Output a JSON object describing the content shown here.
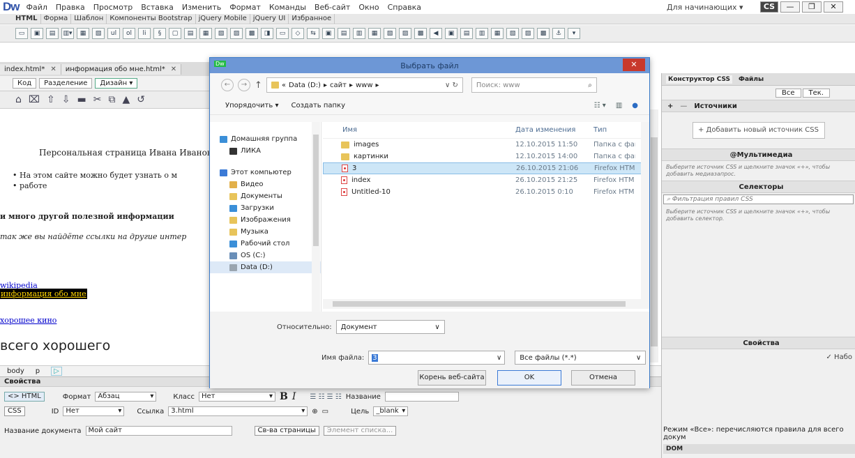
{
  "app": {
    "logo": "Dw",
    "menu": [
      "Файл",
      "Правка",
      "Просмотр",
      "Вставка",
      "Изменить",
      "Формат",
      "Команды",
      "Веб-сайт",
      "Окно",
      "Справка"
    ],
    "workspace": "Для начинающих ▾",
    "cs_label": "CS"
  },
  "insert_tabs": [
    "HTML",
    "Форма",
    "Шаблон",
    "Компоненты Bootstrap",
    "jQuery Mobile",
    "jQuery UI",
    "Избранное"
  ],
  "insert_icons": [
    "▭",
    "▣",
    "▤",
    "▥▾",
    "▦",
    "▧",
    "ul",
    "ol",
    "li",
    "§",
    "▢",
    "▤",
    "▦",
    "▧",
    "▨",
    "▩",
    "◨",
    "▭",
    "◇",
    "⇆",
    "▣",
    "▤",
    "▥",
    "▦",
    "▧",
    "▨",
    "▩",
    "◀",
    "▣",
    "▤",
    "▥",
    "▦",
    "▧",
    "▨",
    "▩",
    "⚓",
    "▾"
  ],
  "doc_tabs": [
    {
      "label": "index.html*"
    },
    {
      "label": "информация обо мне.html*"
    }
  ],
  "views": [
    "Код",
    "Разделение",
    "Дизайн ▾"
  ],
  "doc_tools": [
    "⌂",
    "⌧",
    "⇧",
    "⇩",
    "▬",
    "✂",
    "⧉",
    "▲",
    "↺"
  ],
  "design": {
    "title": "Персональная страница Ивана Иванов",
    "list": [
      "На этом сайте можно будет узнать о м",
      "работе"
    ],
    "bold_line": "и много другой полезной информации",
    "italic_line": "так же вы найдёте ссылки на другие интер",
    "link1": "wikipedia",
    "highlight": "информация обо мне",
    "link2": "хорошее кино",
    "big": "всего хорошего"
  },
  "tagbar": {
    "body": "body",
    "p": "p",
    "icon": "▷"
  },
  "properties": {
    "header": "Свойства",
    "html_btn": "<> HTML",
    "css_btn": "CSS",
    "format_label": "Формат",
    "format_value": "Абзац",
    "class_label": "Класс",
    "class_value": "Нет",
    "id_label": "ID",
    "id_value": "Нет",
    "link_label": "Ссылка",
    "link_value": "3.html",
    "bold": "B",
    "italic": "I",
    "name_label": "Название",
    "target_label": "Цель",
    "target_value": "_blank",
    "doc_title_label": "Название документа",
    "doc_title_value": "Мой сайт",
    "page_props": "Св-ва страницы",
    "list_item": "Элемент списка..."
  },
  "right_panel": {
    "tabs": [
      "Конструктор CSS",
      "Файлы"
    ],
    "modes": [
      "Все",
      "Тек."
    ],
    "sources": "Источники",
    "add_source": "+ Добавить новый источник CSS",
    "media": "@Мультимедиа",
    "media_hint": "Выберите источник CSS и щелкните значок «+», чтобы добавить медиазапрос.",
    "selectors": "Селекторы",
    "filter_placeholder": "Фильтрация правил CSS",
    "selectors_hint": "Выберите источник CSS и щелкните значок «+», чтобы добавить селектор.",
    "properties": "Свойства",
    "set_checkbox": "✓ Набо",
    "bottom_note": "Режим «Все»: перечисляются правила для всего докум",
    "dom": "DOM"
  },
  "dialog": {
    "title": "Выбрать файл",
    "close": "✕",
    "path": [
      "Data (D:)",
      "сайт",
      "www"
    ],
    "search_placeholder": "Поиск: www",
    "organize": "Упорядочить ▾",
    "new_folder": "Создать папку",
    "nav": [
      {
        "label": "Домашняя группа",
        "color": "#3b8fd8",
        "child": false
      },
      {
        "label": "ЛИКА",
        "color": "#333333",
        "child": true
      },
      {
        "label": "",
        "color": "",
        "gap": true
      },
      {
        "label": "Этот компьютер",
        "color": "#3b7ad6",
        "child": false
      },
      {
        "label": "Видео",
        "color": "#e2b04a",
        "child": true
      },
      {
        "label": "Документы",
        "color": "#e8c45a",
        "child": true
      },
      {
        "label": "Загрузки",
        "color": "#3b8fd8",
        "child": true
      },
      {
        "label": "Изображения",
        "color": "#e8c45a",
        "child": true
      },
      {
        "label": "Музыка",
        "color": "#e8c45a",
        "child": true
      },
      {
        "label": "Рабочий стол",
        "color": "#3b8fd8",
        "child": true
      },
      {
        "label": "OS (C:)",
        "color": "#6a8fb8",
        "child": true
      },
      {
        "label": "Data (D:)",
        "color": "#9aa5b0",
        "child": true,
        "selected": true
      }
    ],
    "columns": {
      "name": "Имя",
      "date": "Дата изменения",
      "type": "Тип"
    },
    "files": [
      {
        "name": "images",
        "date": "12.10.2015 11:50",
        "type": "Папка с фай",
        "kind": "folder"
      },
      {
        "name": "картинки",
        "date": "12.10.2015 14:00",
        "type": "Папка с фай",
        "kind": "folder"
      },
      {
        "name": "3",
        "date": "26.10.2015 21:06",
        "type": "Firefox HTM",
        "kind": "file",
        "selected": true
      },
      {
        "name": "index",
        "date": "26.10.2015 21:25",
        "type": "Firefox HTM",
        "kind": "file"
      },
      {
        "name": "Untitled-10",
        "date": "26.10.2015 0:10",
        "type": "Firefox HTM",
        "kind": "file"
      }
    ],
    "relative_label": "Относительно:",
    "relative_value": "Документ",
    "filename_label": "Имя файла:",
    "filename_value": "3",
    "filetype_value": "Все файлы (*.*)",
    "site_root": "Корень веб-сайта",
    "ok": "OK",
    "cancel": "Отмена"
  }
}
